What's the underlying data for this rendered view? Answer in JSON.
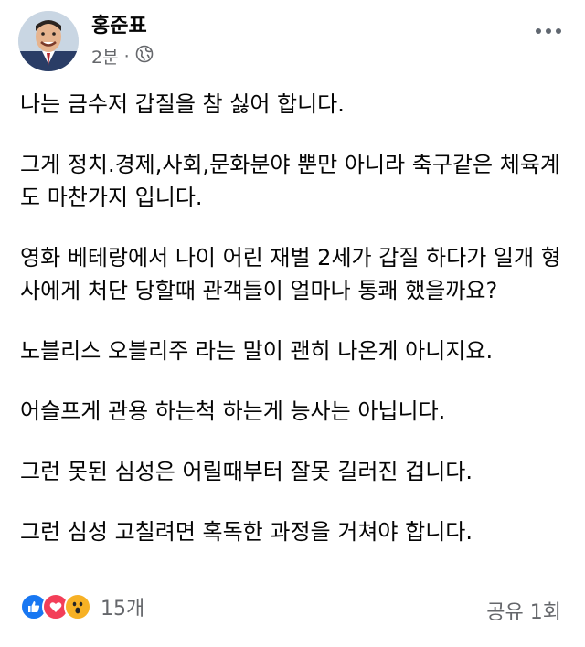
{
  "post": {
    "author": "홍준표",
    "time": "2분",
    "separator": "·",
    "privacy_icon": "globe-icon",
    "paragraphs": [
      "나는 금수저 갑질을 참 싫어 합니다.",
      "그게 정치.경제,사회,문화분야 뿐만 아니라 축구같은 체육계도 마찬가지 입니다.",
      "영화 베테랑에서 나이 어린 재벌 2세가 갑질 하다가 일개 형사에게 처단 당할때 관객들이 얼마나 통쾌 했을까요?",
      "노블리스 오블리주 라는 말이 괜히 나온게 아니지요.",
      "어슬프게 관용 하는척 하는게 능사는 아닙니다.",
      "그런 못된 심성은 어릴때부터 잘못 길러진 겁니다.",
      "그런 심성 고칠려면 혹독한 과정을 거쳐야 합니다."
    ]
  },
  "footer": {
    "reaction_icons": [
      "like-icon",
      "love-icon",
      "wow-icon"
    ],
    "reaction_count": "15개",
    "shares": "공유 1회"
  },
  "colors": {
    "like": "#1877f2",
    "love": "#f33e58",
    "wow": "#f7b125",
    "secondary_text": "#65676b"
  }
}
